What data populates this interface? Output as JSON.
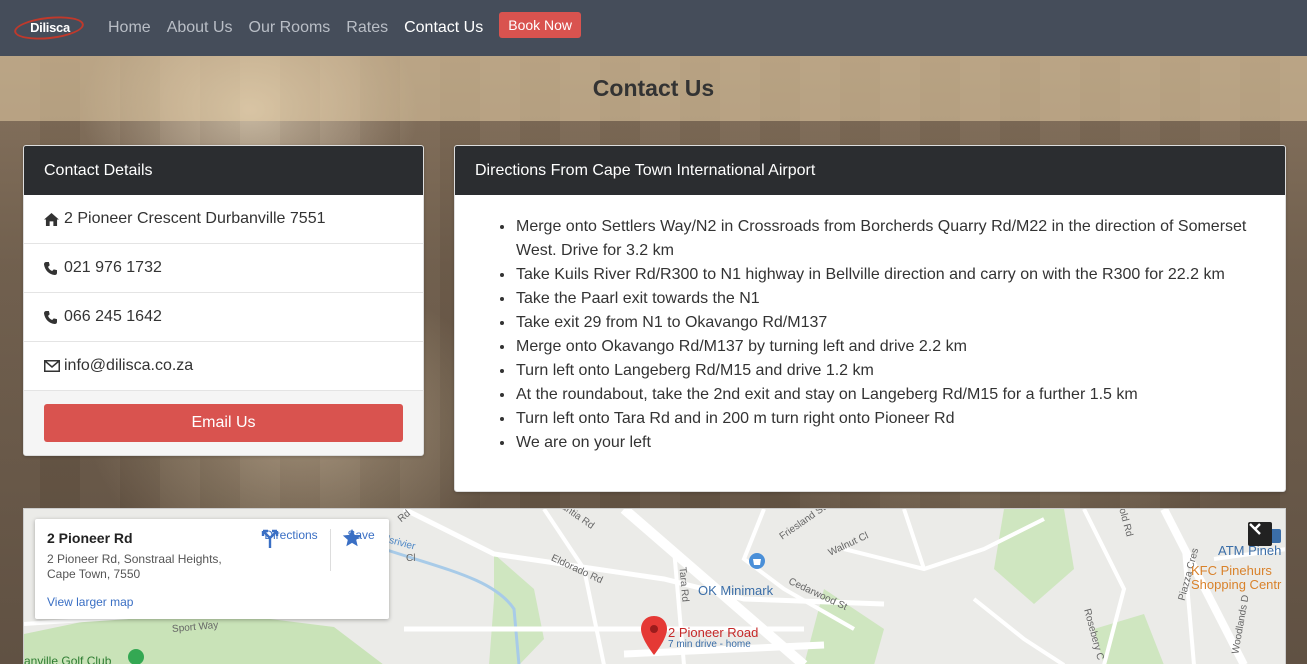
{
  "nav": {
    "logo_text": "Dilisca",
    "links": [
      "Home",
      "About Us",
      "Our Rooms",
      "Rates",
      "Contact Us"
    ],
    "book_label": "Book Now"
  },
  "page_title": "Contact Us",
  "contact": {
    "header": "Contact Details",
    "address": "2 Pioneer Crescent Durbanville 7551",
    "phone1": "021 976 1732",
    "phone2": "066 245 1642",
    "email": "info@dilisca.co.za",
    "email_button": "Email Us"
  },
  "directions": {
    "header": "Directions From Cape Town International Airport",
    "steps": [
      "Merge onto Settlers Way/N2 in Crossroads from Borcherds Quarry Rd/M22 in the direction of Somerset West. Drive for 3.2 km",
      "Take Kuils River Rd/R300 to N1 highway in Bellville direction and carry on with the R300 for 22.2 km",
      "Take the Paarl exit towards the N1",
      "Take exit 29 from N1 to Okavango Rd/M137",
      "Merge onto Okavango Rd/M137 by turning left and drive 2.2 km",
      "Turn left onto Langeberg Rd/M15 and drive 1.2 km",
      "At the roundabout, take the 2nd exit and stay on Langeberg Rd/M15 for a further 1.5 km",
      "Turn left onto Tara Rd and in 200 m turn right onto Pioneer Rd",
      "We are on your left"
    ]
  },
  "map": {
    "place_title": "2 Pioneer Rd",
    "place_address": "2 Pioneer Rd, Sonstraal Heights, Cape Town, 7550",
    "directions_label": "Directions",
    "save_label": "Save",
    "larger_map_label": "View larger map",
    "pin_label": "2 Pioneer Road",
    "pin_sub": "7 min drive - home",
    "poi_ok": "OK Minimark",
    "poi_atm": "ATM Pineh",
    "poi_kfc": "KFC Pinehurs Shopping Centr",
    "poi_golf": "anville Golf Club",
    "street_labels": [
      "Sport Way",
      "uilsrivier",
      "Eldorado Rd",
      "Tara Rd",
      "Cedarwood St",
      "Walnut Cl",
      "Friesland St",
      "Piazza Cres",
      "Rosebery C",
      "Woodlands D",
      "old Rd",
      "antia Rd",
      "Cl",
      "Rd"
    ]
  }
}
